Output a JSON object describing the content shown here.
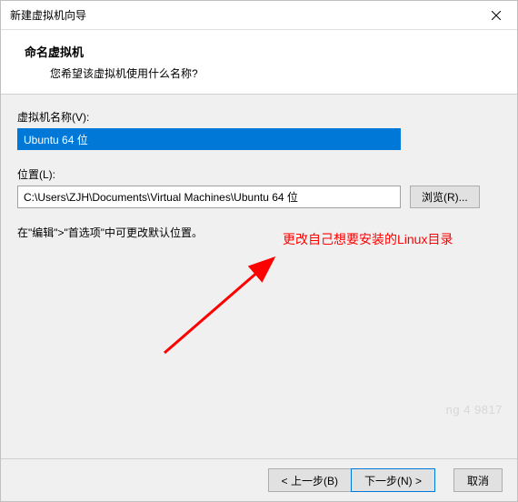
{
  "window": {
    "title": "新建虚拟机向导"
  },
  "header": {
    "title": "命名虚拟机",
    "subtitle": "您希望该虚拟机使用什么名称?"
  },
  "fields": {
    "name_label": "虚拟机名称(V):",
    "name_value": "Ubuntu 64 位",
    "location_label": "位置(L):",
    "location_value": "C:\\Users\\ZJH\\Documents\\Virtual Machines\\Ubuntu 64 位",
    "browse_label": "浏览(R)...",
    "hint": "在\"编辑\">\"首选项\"中可更改默认位置。"
  },
  "annotation": {
    "text": "更改自己想要安装的Linux目录"
  },
  "buttons": {
    "back": "< 上一步(B)",
    "next": "下一步(N) >",
    "cancel": "取消"
  },
  "watermark": "ng 4     9817"
}
